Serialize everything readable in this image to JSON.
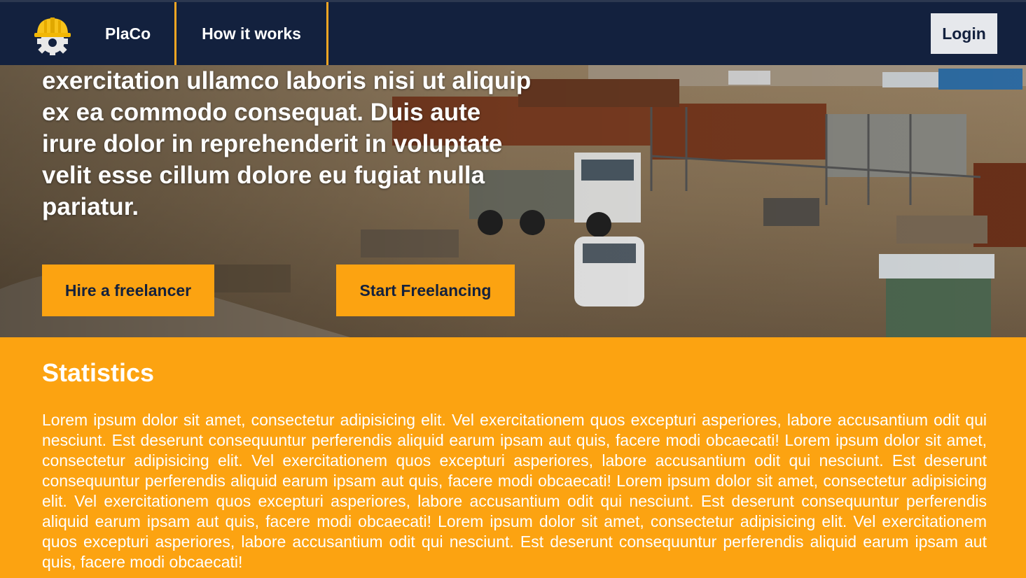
{
  "navbar": {
    "logo_icon": "hardhat-gear-icon",
    "brand": "PlaCo",
    "how_it_works": "How it works",
    "login": "Login"
  },
  "hero": {
    "background": "construction-site-photo",
    "text": "exercitation ullamco laboris nisi ut aliquip ex ea commodo consequat. Duis aute irure dolor in reprehenderit in voluptate velit esse cillum dolore eu fugiat nulla pariatur.",
    "hire_button": "Hire a freelancer",
    "start_button": "Start Freelancing"
  },
  "statistics": {
    "title": "Statistics",
    "body": "Lorem ipsum dolor sit amet, consectetur adipisicing elit. Vel exercitationem quos excepturi asperiores, labore accusantium odit qui nesciunt. Est deserunt consequuntur perferendis aliquid earum ipsam aut quis, facere modi obcaecati! Lorem ipsum dolor sit amet, consectetur adipisicing elit. Vel exercitationem quos excepturi asperiores, labore accusantium odit qui nesciunt. Est deserunt consequuntur perferendis aliquid earum ipsam aut quis, facere modi obcaecati! Lorem ipsum dolor sit amet, consectetur adipisicing elit. Vel exercitationem quos excepturi asperiores, labore accusantium odit qui nesciunt. Est deserunt consequuntur perferendis aliquid earum ipsam aut quis, facere modi obcaecati! Lorem ipsum dolor sit amet, consectetur adipisicing elit. Vel exercitationem quos excepturi asperiores, labore accusantium odit qui nesciunt. Est deserunt consequuntur perferendis aliquid earum ipsam aut quis, facere modi obcaecati!"
  },
  "colors": {
    "navbar_bg": "#13213e",
    "accent": "#fca311",
    "nav_divider": "#f5a623",
    "login_bg": "#e6e8ec",
    "text_light": "#ffffff",
    "text_dark": "#14213d"
  }
}
